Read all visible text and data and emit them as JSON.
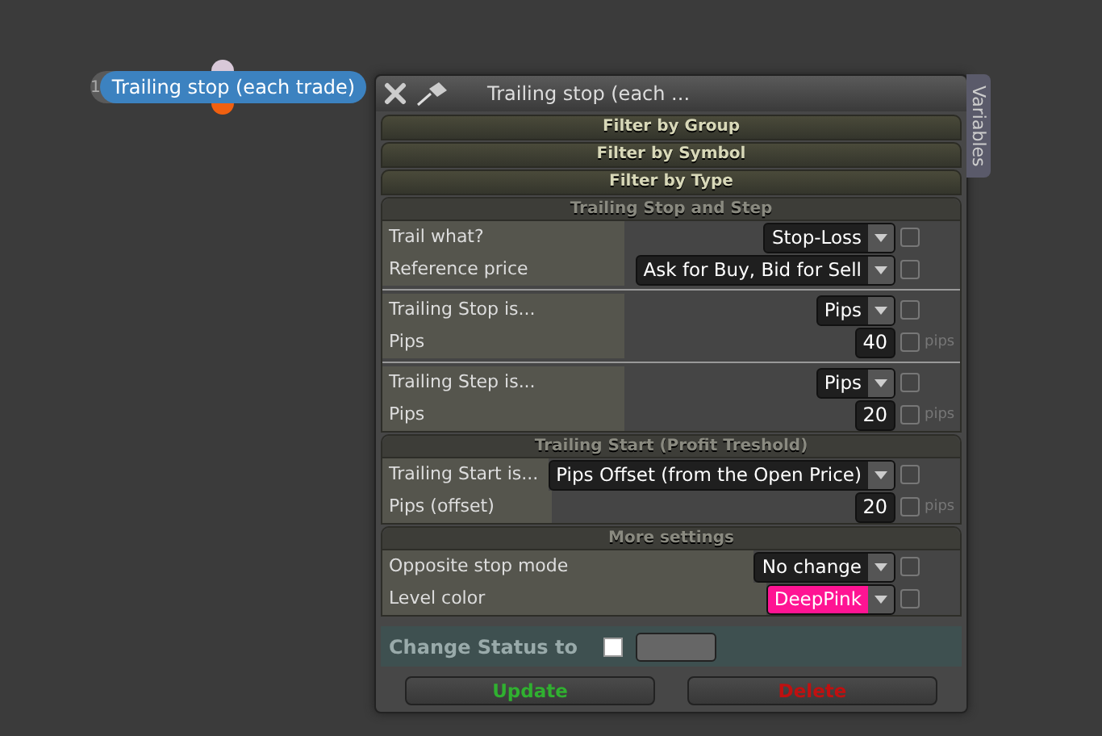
{
  "node": {
    "index": "1",
    "title": "Trailing stop (each trade)"
  },
  "panel": {
    "title": "Trailing stop (each ...",
    "side_tab": "Variables",
    "filters": [
      "Filter by Group",
      "Filter by Symbol",
      "Filter by Type"
    ],
    "sections": [
      {
        "title": "Trailing Stop and Step",
        "groups": [
          [
            {
              "label": "Trail what?",
              "kind": "select",
              "value": "Stop-Loss",
              "checked": false
            },
            {
              "label": "Reference price",
              "kind": "select",
              "value": "Ask for Buy, Bid for Sell",
              "checked": false
            }
          ],
          [
            {
              "label": "Trailing Stop is...",
              "kind": "select",
              "value": "Pips",
              "checked": false
            },
            {
              "label": "Pips",
              "kind": "number",
              "value": "40",
              "unit": "pips",
              "checked": false
            }
          ],
          [
            {
              "label": "Trailing Step is...",
              "kind": "select",
              "value": "Pips",
              "checked": false
            },
            {
              "label": "Pips",
              "kind": "number",
              "value": "20",
              "unit": "pips",
              "checked": false
            }
          ]
        ]
      },
      {
        "title": "Trailing Start (Profit Treshold)",
        "groups": [
          [
            {
              "label": "Trailing Start is...",
              "kind": "select",
              "value": "Pips Offset (from the Open Price)",
              "checked": false
            },
            {
              "label": "Pips (offset)",
              "kind": "number",
              "value": "20",
              "unit": "pips",
              "checked": false
            }
          ]
        ]
      },
      {
        "title": "More settings",
        "groups": [
          [
            {
              "label": "Opposite stop mode",
              "kind": "select",
              "value": "No change",
              "checked": false
            },
            {
              "label": "Level color",
              "kind": "select",
              "value": "DeepPink",
              "color": "#ff1493",
              "checked": false
            }
          ]
        ]
      }
    ],
    "status": {
      "label": "Change Status to",
      "checked": false
    },
    "buttons": [
      {
        "label": "Update",
        "kind": "update"
      },
      {
        "label": "Delete",
        "kind": "delete"
      }
    ]
  }
}
